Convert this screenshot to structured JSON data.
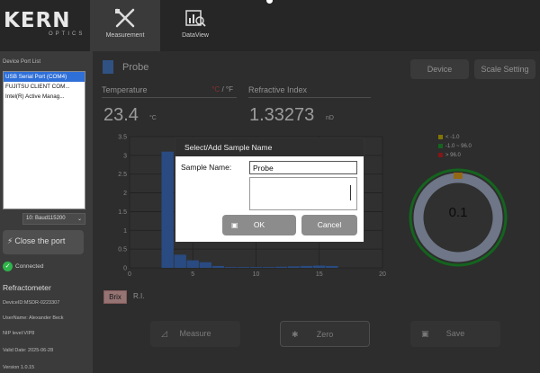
{
  "header": {
    "logo": {
      "main": "KERN",
      "sub": "OPTICS"
    },
    "tabs": [
      {
        "label": "Measurement",
        "icon": "measurement-tools-icon",
        "active": true
      },
      {
        "label": "DataView",
        "icon": "chart-search-icon",
        "active": false
      }
    ]
  },
  "sidebar": {
    "port_list_label": "Device Port List",
    "ports": [
      "USB Serial Port (COM4)",
      "FUJITSU CLIENT COM...",
      "Intel(R) Active Manag..."
    ],
    "baud": "10:  Baud115200",
    "close_port_label": "Close the port",
    "status": "Connected",
    "section_title": "Refractometer",
    "info": [
      "DeviceID:MSDR-0223307",
      "UserName: Alexander Beck",
      "NIP level:VIP8",
      "Valid Date: 2025-06-28",
      "Version 1.0.15"
    ]
  },
  "main": {
    "sample_title": "Probe",
    "buttons": {
      "device": "Device",
      "scale_setting": "Scale Setting"
    },
    "temperature": {
      "label": "Temperature",
      "unit_c": "°C",
      "separator": "/",
      "unit_f": "°F",
      "value": "23.4",
      "unit": "°C"
    },
    "refractive_index": {
      "label": "Refractive Index",
      "value": "1.33273",
      "unit": "nD"
    },
    "legend": [
      {
        "label": "< -1.0",
        "color": "#c8b400"
      },
      {
        "label": "-1.0 ~ 96.0",
        "color": "#1f9a2e"
      },
      {
        "label": "> 96.0",
        "color": "#cc2222"
      }
    ],
    "gauge": {
      "value": "0.1",
      "ring_color": "#1f9a2e",
      "track_color": "#a9b6cf",
      "marker_color": "#e0a020"
    },
    "modes": {
      "brix": "Brix",
      "ri": "R.I."
    },
    "actions": {
      "measure": "Measure",
      "zero": "Zero",
      "save": "Save"
    }
  },
  "dialog": {
    "title": "Select/Add Sample Name",
    "label": "Sample Name:",
    "value": "Probe",
    "ok": "OK",
    "cancel": "Cancel"
  },
  "chart_data": {
    "type": "bar",
    "x": [
      3,
      4,
      5,
      6,
      7,
      8,
      9,
      10,
      11,
      12,
      13,
      14,
      15,
      16
    ],
    "values": [
      3.1,
      0.35,
      0.2,
      0.15,
      0.05,
      0.02,
      0.02,
      0.02,
      0.02,
      0.03,
      0.04,
      0.05,
      0.06,
      0.05
    ],
    "xlim": [
      0,
      20
    ],
    "ylim": [
      0,
      3.5
    ],
    "xticks": [
      0,
      5,
      10,
      15,
      20
    ],
    "yticks": [
      0,
      0.5,
      1,
      1.5,
      2,
      2.5,
      3,
      3.5
    ],
    "ytick_labels": [
      "0",
      "0.5",
      "1",
      "1.5",
      "2",
      "2.5",
      "3",
      "3.5"
    ],
    "bar_color": "#3f74c8",
    "grid": true
  }
}
